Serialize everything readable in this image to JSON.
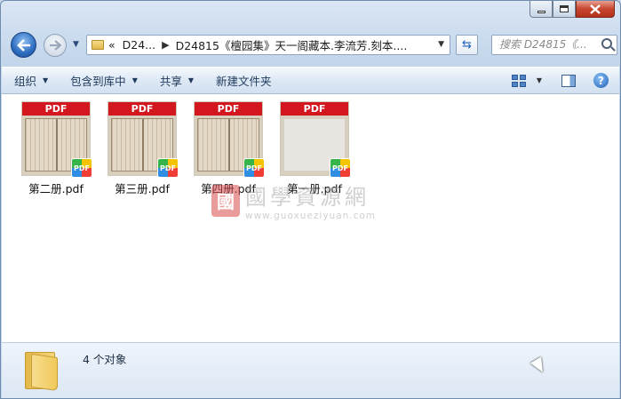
{
  "window": {
    "caption_buttons": [
      "minimize",
      "maximize",
      "close"
    ]
  },
  "nav": {
    "back_icon": "back-arrow-icon",
    "forward_icon": "forward-arrow-icon",
    "breadcrumb": {
      "overflow": "«",
      "parent": "D24...",
      "current": "D24815《檀园集》天一阁藏本.李流芳.刻本...."
    },
    "search_placeholder": "搜索 D24815《..."
  },
  "toolbar": {
    "organize": "组织",
    "include_in_library": "包含到库中",
    "share": "共享",
    "new_folder": "新建文件夹"
  },
  "files": [
    {
      "name": "第二册.pdf",
      "header": "PDF",
      "badge": "PDF"
    },
    {
      "name": "第三册.pdf",
      "header": "PDF",
      "badge": "PDF"
    },
    {
      "name": "第四册.pdf",
      "header": "PDF",
      "badge": "PDF"
    },
    {
      "name": "第一册.pdf",
      "header": "PDF",
      "badge": "PDF"
    }
  ],
  "watermark": {
    "seal": "tbd",
    "cn": "國學資源網",
    "url": "www.guoxueziyuan.com"
  },
  "status": {
    "count": "4 个对象"
  }
}
